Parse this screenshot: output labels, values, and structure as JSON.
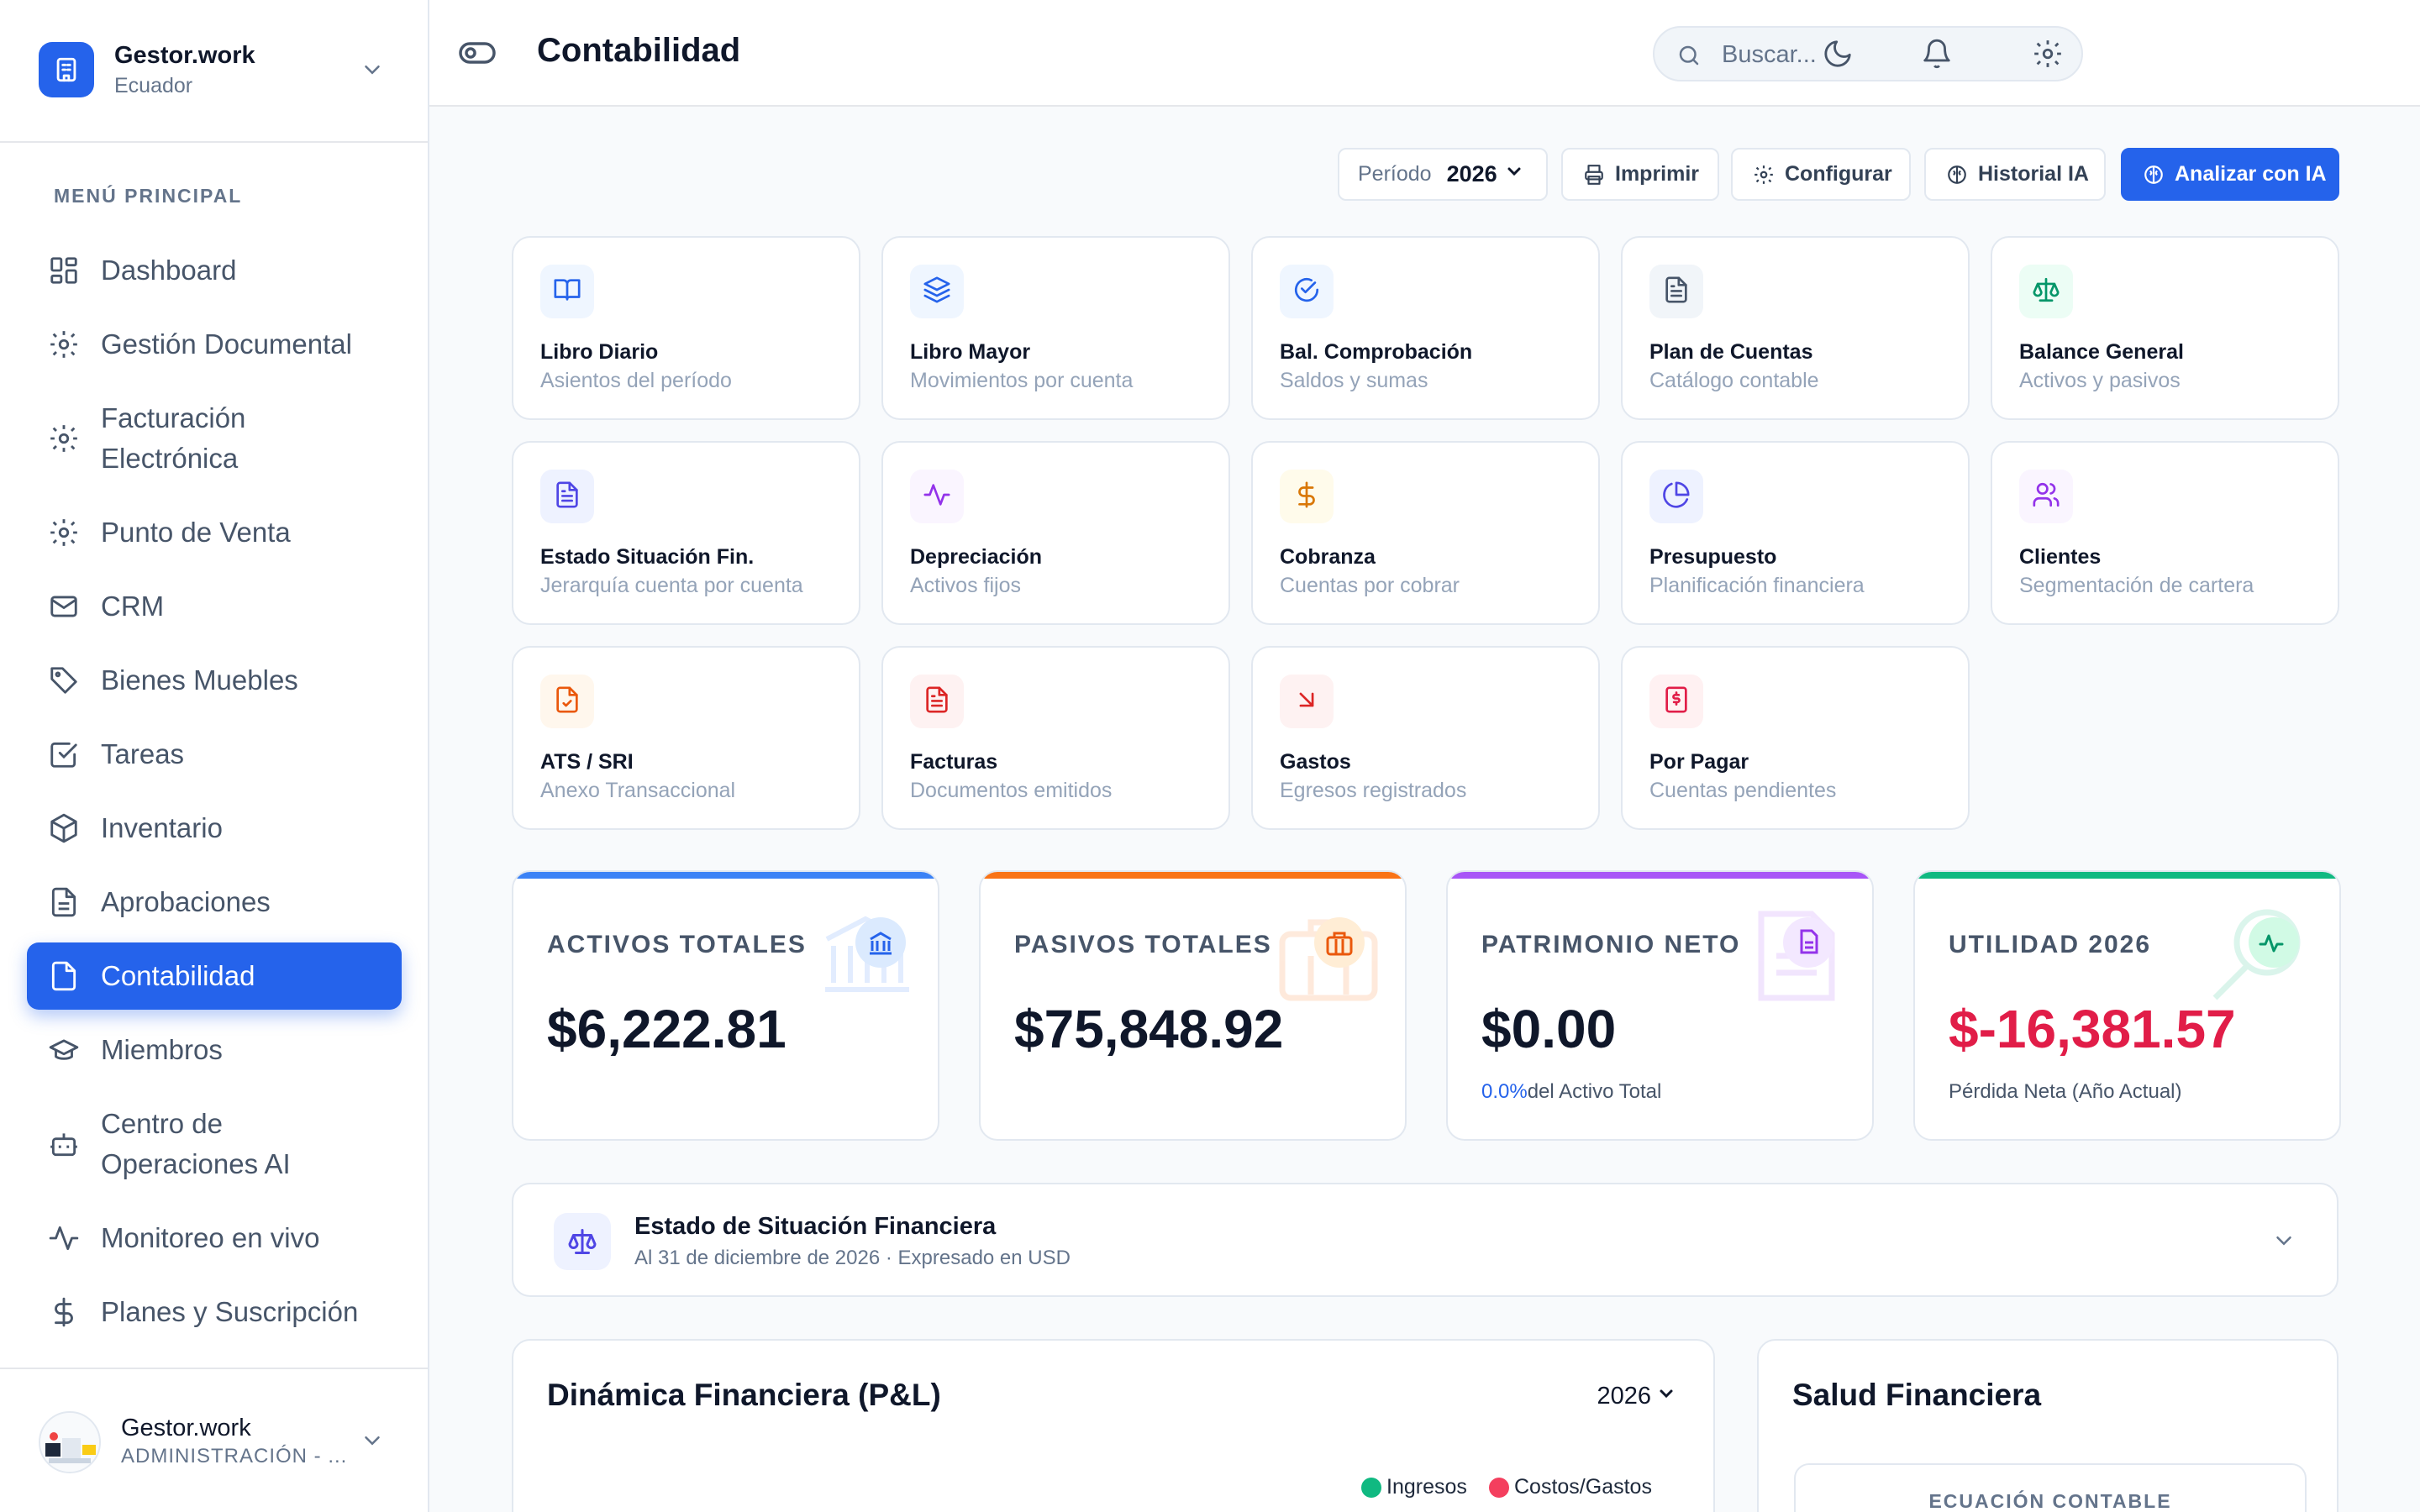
{
  "workspace": {
    "name": "Gestor.work",
    "country": "Ecuador"
  },
  "sidebar": {
    "menu_title": "MENÚ PRINCIPAL",
    "items": [
      {
        "label": "Dashboard",
        "icon": "grid-icon"
      },
      {
        "label": "Gestión Documental",
        "icon": "gear-icon"
      },
      {
        "label": "Facturación Electrónica",
        "icon": "gear-icon"
      },
      {
        "label": "Punto de Venta",
        "icon": "gear-icon"
      },
      {
        "label": "CRM",
        "icon": "mail-icon"
      },
      {
        "label": "Bienes Muebles",
        "icon": "tag-icon"
      },
      {
        "label": "Tareas",
        "icon": "checkbox-icon"
      },
      {
        "label": "Inventario",
        "icon": "box-icon"
      },
      {
        "label": "Aprobaciones",
        "icon": "document-icon"
      },
      {
        "label": "Contabilidad",
        "icon": "file-icon"
      },
      {
        "label": "Miembros",
        "icon": "graduation-cap-icon"
      },
      {
        "label": "Centro de Operaciones AI",
        "icon": "bot-icon"
      },
      {
        "label": "Monitoreo en vivo",
        "icon": "activity-icon"
      },
      {
        "label": "Planes y Suscripción",
        "icon": "dollar-icon"
      }
    ],
    "active_item": "Contabilidad"
  },
  "user": {
    "name": "Gestor.work",
    "role": "ADMINISTRACIÓN - ..."
  },
  "header": {
    "title": "Contabilidad",
    "search_placeholder": "Buscar..."
  },
  "toolbar": {
    "period_label": "Período",
    "period_value": "2026",
    "print": "Imprimir",
    "configure": "Configurar",
    "history": "Historial IA",
    "analyze": "Analizar con IA"
  },
  "modules": [
    {
      "title": "Libro Diario",
      "subtitle": "Asientos del período",
      "icon": "book-open-icon",
      "color": "#2563eb",
      "bg": "#eff6ff"
    },
    {
      "title": "Libro Mayor",
      "subtitle": "Movimientos por cuenta",
      "icon": "layers-icon",
      "color": "#2563eb",
      "bg": "#eff6ff"
    },
    {
      "title": "Bal. Comprobación",
      "subtitle": "Saldos y sumas",
      "icon": "check-circle-icon",
      "color": "#2563eb",
      "bg": "#eff6ff"
    },
    {
      "title": "Plan de Cuentas",
      "subtitle": "Catálogo contable",
      "icon": "file-text-icon",
      "color": "#475569",
      "bg": "#f1f5f9"
    },
    {
      "title": "Balance General",
      "subtitle": "Activos y pasivos",
      "icon": "scale-icon",
      "color": "#059669",
      "bg": "#ecfdf5"
    },
    {
      "title": "Estado Situación Fin.",
      "subtitle": "Jerarquía cuenta por cuenta",
      "icon": "file-text-icon",
      "color": "#4f46e5",
      "bg": "#eef2ff"
    },
    {
      "title": "Depreciación",
      "subtitle": "Activos fijos",
      "icon": "activity-icon",
      "color": "#9333ea",
      "bg": "#faf5ff"
    },
    {
      "title": "Cobranza",
      "subtitle": "Cuentas por cobrar",
      "icon": "dollar-icon",
      "color": "#d97706",
      "bg": "#fffbeb"
    },
    {
      "title": "Presupuesto",
      "subtitle": "Planificación financiera",
      "icon": "pie-chart-icon",
      "color": "#4f46e5",
      "bg": "#eef2ff"
    },
    {
      "title": "Clientes",
      "subtitle": "Segmentación de cartera",
      "icon": "users-icon",
      "color": "#9333ea",
      "bg": "#faf5ff"
    },
    {
      "title": "ATS / SRI",
      "subtitle": "Anexo Transaccional",
      "icon": "file-check-icon",
      "color": "#ea580c",
      "bg": "#fff7ed"
    },
    {
      "title": "Facturas",
      "subtitle": "Documentos emitidos",
      "icon": "file-text-icon",
      "color": "#dc2626",
      "bg": "#fef2f2"
    },
    {
      "title": "Gastos",
      "subtitle": "Egresos registrados",
      "icon": "arrow-down-right-icon",
      "color": "#dc2626",
      "bg": "#fef2f2"
    },
    {
      "title": "Por Pagar",
      "subtitle": "Cuentas pendientes",
      "icon": "receipt-icon",
      "color": "#e11d48",
      "bg": "#fff1f2"
    }
  ],
  "kpis": [
    {
      "label": "ACTIVOS TOTALES",
      "value": "$6,222.81",
      "note_pct": "",
      "note": "",
      "accent": "#3b82f6",
      "value_color": "#0f172a",
      "icon": "bank-icon"
    },
    {
      "label": "PASIVOS TOTALES",
      "value": "$75,848.92",
      "note_pct": "",
      "note": "",
      "accent": "#f97316",
      "value_color": "#0f172a",
      "icon": "briefcase-icon"
    },
    {
      "label": "PATRIMONIO NETO",
      "value": "$0.00",
      "note_pct": "0.0%",
      "note": "del Activo Total",
      "accent": "#a855f7",
      "value_color": "#0f172a",
      "icon": "document-icon"
    },
    {
      "label": "UTILIDAD 2026",
      "value": "$-16,381.57",
      "note_pct": "",
      "note": "Pérdida Neta (Año Actual)",
      "accent": "#10b981",
      "value_color": "#e11d48",
      "icon": "activity-icon"
    }
  ],
  "estado": {
    "title": "Estado de Situación Financiera",
    "subtitle": "Al 31 de diciembre de 2026 · Expresado en USD"
  },
  "pl_panel": {
    "title": "Dinámica Financiera (P&L)",
    "year": "2026",
    "legend": [
      {
        "name": "Ingresos",
        "color": "#10b981"
      },
      {
        "name": "Costos/Gastos",
        "color": "#f43f5e"
      }
    ]
  },
  "health_panel": {
    "title": "Salud Financiera",
    "inner_label": "ECUACIÓN CONTABLE"
  }
}
